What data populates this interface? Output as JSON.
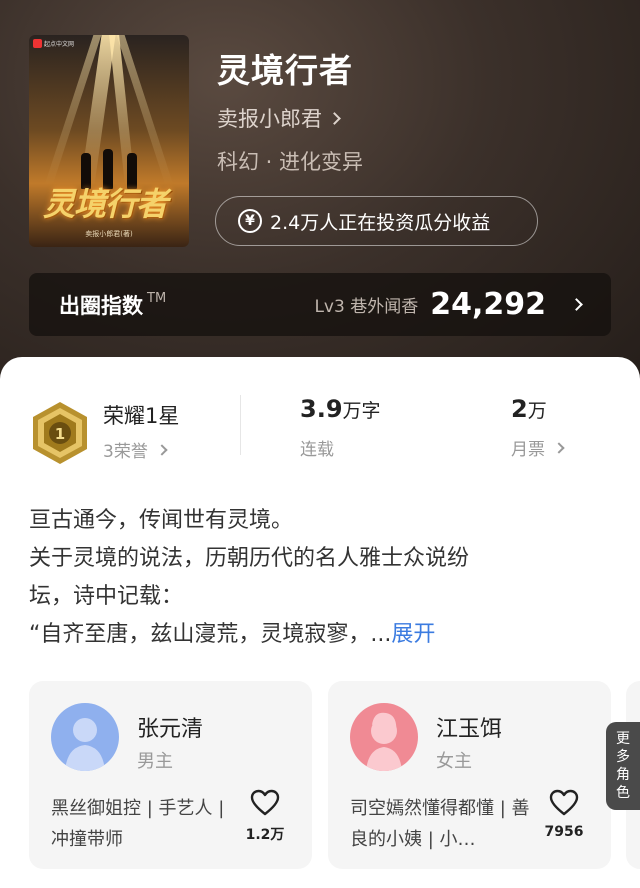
{
  "book": {
    "title": "灵境行者",
    "author": "卖报小郎君",
    "genre": "科幻 · 进化变异",
    "cover_title": "灵境行者",
    "cover_author": "卖报小郎君(著)",
    "cover_logo_text": "起点中文网"
  },
  "invest": {
    "icon": "yen-icon",
    "label": "2.4万人正在投资瓜分收益"
  },
  "breakout_index": {
    "label": "出圈指数",
    "tm": "TM",
    "level": "Lv3 巷外闻香",
    "value": "24,292"
  },
  "stats": {
    "honor_title": "荣耀1星",
    "honor_sub": "3荣誉",
    "badge_number": "1",
    "words_value": "3.9",
    "words_unit": "万字",
    "words_status": "连载",
    "votes_value": "2",
    "votes_unit": "万",
    "votes_label": "月票"
  },
  "synopsis": {
    "line1": "亘古通今，传闻世有灵境。",
    "line2": "关于灵境的说法，历朝历代的名人雅士众说纷",
    "line3": "坛，诗中记载：",
    "line4": "“自齐至唐，兹山寖荒，灵境寂寥，",
    "ellipsis": "...",
    "expand": "展开"
  },
  "characters": [
    {
      "name": "张元清",
      "role": "男主",
      "desc": "黑丝御姐控 | 手艺人 | 冲撞带师",
      "likes": "1.2万",
      "avatar_color": "#8fb0ee"
    },
    {
      "name": "江玉饵",
      "role": "女主",
      "desc": "司空嫣然懂得都懂 | 善良的小姨 | 小…",
      "likes": "7956",
      "avatar_color": "#f08a94"
    }
  ],
  "more_characters": "更多角色",
  "colors": {
    "accent_link": "#3b7be0",
    "hero_bg": "#3b302a"
  }
}
